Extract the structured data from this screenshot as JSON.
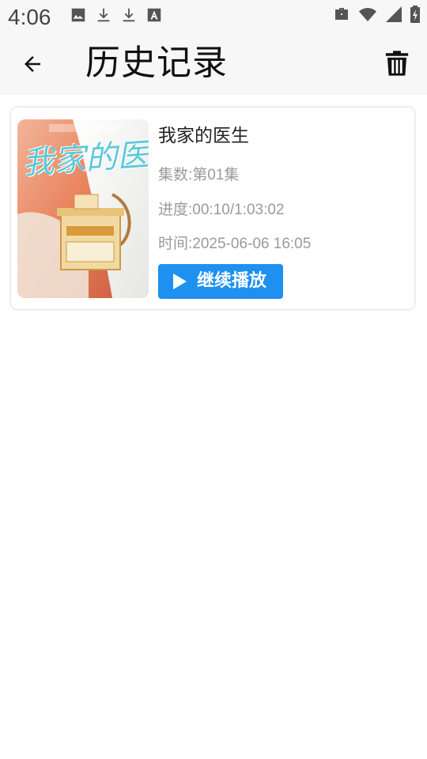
{
  "status_bar": {
    "time": "4:06",
    "left_icons": [
      "image-icon",
      "download-icon",
      "download-icon",
      "font-icon"
    ],
    "right_icons": [
      "briefcase-icon",
      "wifi-icon",
      "signal-icon",
      "battery-charging-icon"
    ]
  },
  "app_bar": {
    "title": "历史记录",
    "back_icon": "arrow-left-icon",
    "delete_icon": "trash-icon"
  },
  "history": [
    {
      "title": "我家的医生",
      "poster_text": "我家的医生",
      "episode": "集数:第01集",
      "progress": "进度:00:10/1:03:02",
      "time": "时间:2025-06-06 16:05",
      "button_label": "继续播放"
    }
  ],
  "colors": {
    "accent": "#1e90f0",
    "meta_text": "#9a9a9a",
    "bar_bg": "#f7f7f7"
  }
}
